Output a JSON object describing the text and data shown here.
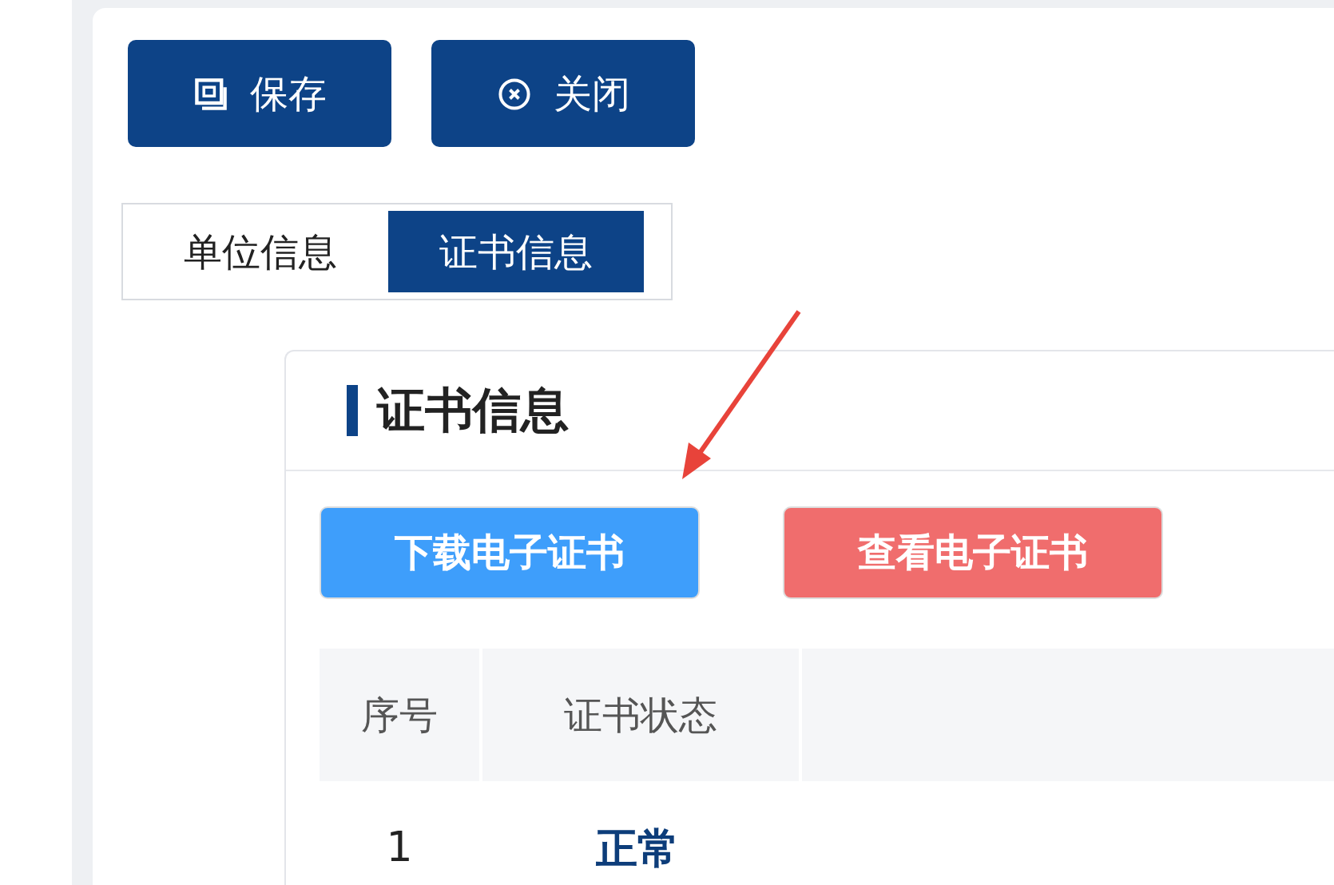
{
  "toolbar": [
    {
      "kind": "save",
      "label": "保存"
    },
    {
      "kind": "close",
      "label": "关闭"
    }
  ],
  "tabs": [
    {
      "label": "单位信息",
      "selected": false
    },
    {
      "label": "证书信息",
      "selected": true
    }
  ],
  "section": {
    "title": "证书信息",
    "actions": [
      {
        "kind": "primary",
        "label": "下载电子证书"
      },
      {
        "kind": "danger",
        "label": "查看电子证书"
      }
    ],
    "table": {
      "columns": [
        "序号",
        "证书状态"
      ],
      "rows": [
        {
          "index": "1",
          "status": "正常"
        }
      ]
    }
  }
}
